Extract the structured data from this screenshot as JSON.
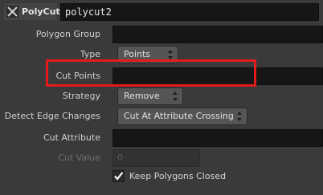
{
  "header": {
    "node_type": "PolyCut",
    "node_name": "polycut2",
    "node_icon": "polycut-node-icon"
  },
  "parms": {
    "polygon_group": {
      "label": "Polygon Group",
      "value": ""
    },
    "type": {
      "label": "Type",
      "value": "Points"
    },
    "cut_points": {
      "label": "Cut Points",
      "value": ""
    },
    "strategy": {
      "label": "Strategy",
      "value": "Remove"
    },
    "detect_edge_changes": {
      "label": "Detect Edge Changes",
      "value": "Cut At Attribute Crossing"
    },
    "cut_attribute": {
      "label": "Cut Attribute",
      "value": ""
    },
    "cut_value": {
      "label": "Cut Value",
      "value": "0",
      "enabled": false
    },
    "keep_polygons_closed": {
      "label": "Keep Polygons Closed",
      "checked": true
    }
  },
  "annotation": {
    "color": "#e31b1b",
    "target": "cut_points"
  }
}
